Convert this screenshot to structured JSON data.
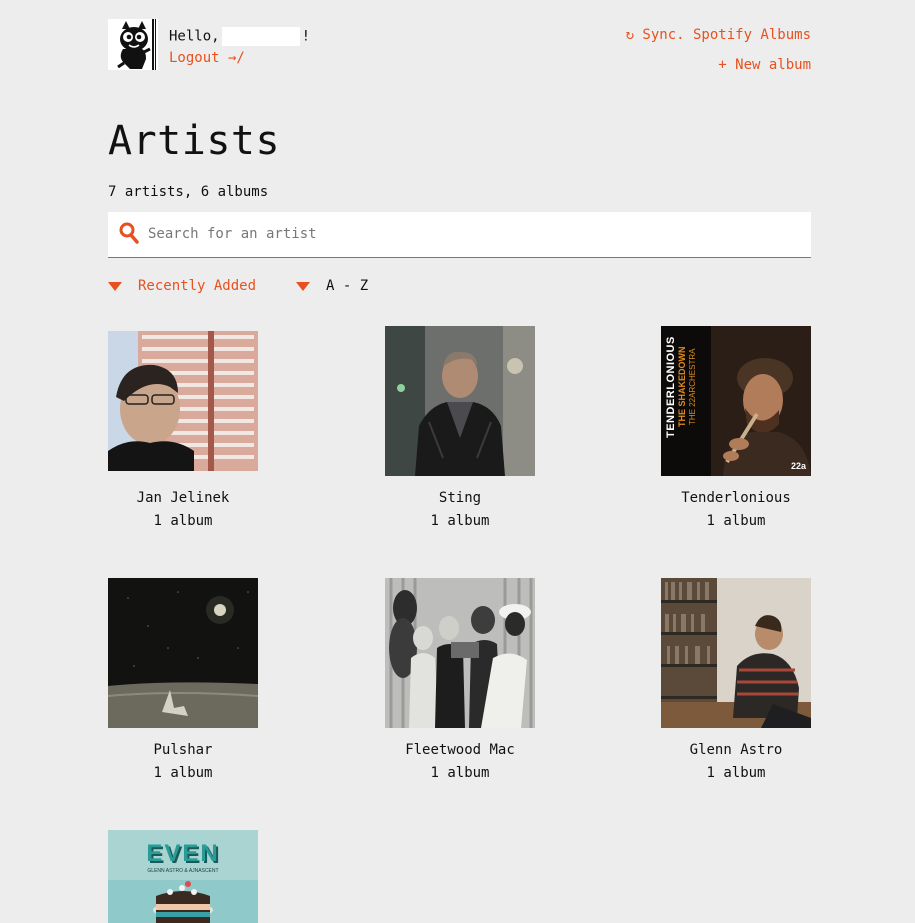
{
  "header": {
    "greeting_prefix": "Hello,",
    "greeting_suffix": "!",
    "logout_label": "Logout →/",
    "sync_label": "↻ Sync. Spotify Albums",
    "new_album_label": "+  New album"
  },
  "page": {
    "title": "Artists",
    "counts": "7 artists, 6 albums"
  },
  "search": {
    "placeholder": "Search for an artist",
    "value": ""
  },
  "sort": {
    "recent_label": "Recently Added",
    "az_label": "A - Z",
    "active": "recent"
  },
  "colors": {
    "accent": "#e8511f",
    "background": "#ededed"
  },
  "artists": [
    {
      "name": "Jan Jelinek",
      "count": "1 album"
    },
    {
      "name": "Sting",
      "count": "1 album"
    },
    {
      "name": "Tenderlonious",
      "count": "1 album",
      "cover_text": [
        "TENDERLONIOUS",
        "THE SHAKEDOWN",
        "THE 22ARCHESTRA",
        "22a"
      ]
    },
    {
      "name": "Pulshar",
      "count": "1 album"
    },
    {
      "name": "Fleetwood Mac",
      "count": "1 album"
    },
    {
      "name": "Glenn Astro",
      "count": "1 album"
    },
    {
      "name": "",
      "count": "",
      "cover_text": [
        "EVEN",
        "GLENN ASTRO & AJNASCENT"
      ]
    }
  ]
}
